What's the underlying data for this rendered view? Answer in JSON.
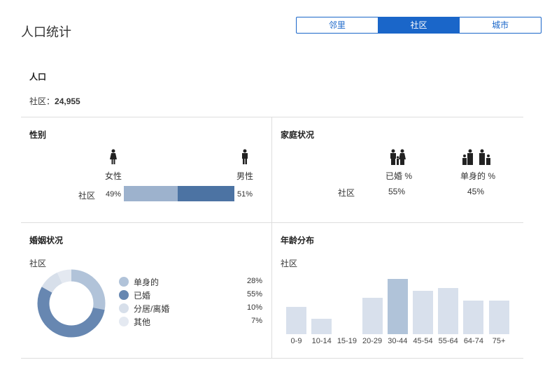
{
  "title": "人口统计",
  "tabs": [
    {
      "label": "邻里"
    },
    {
      "label": "社区",
      "active": true
    },
    {
      "label": "城市"
    }
  ],
  "population": {
    "heading": "人口",
    "label": "社区：",
    "value": "24,955"
  },
  "gender": {
    "heading": "性别",
    "female_label": "女性",
    "male_label": "男性",
    "row_label": "社区",
    "female_pct": "49%",
    "male_pct": "51%",
    "female_value": 49,
    "male_value": 51,
    "colors": {
      "female": "#9db2cd",
      "male": "#4c73a3"
    }
  },
  "family": {
    "heading": "家庭状况",
    "married_label": "已婚 %",
    "single_label": "单身的 %",
    "row_label": "社区",
    "married_pct": "55%",
    "single_pct": "45%"
  },
  "marital": {
    "heading": "婚姻状况",
    "sub": "社区",
    "items": [
      {
        "label": "单身的",
        "pct": "28%",
        "value": 28,
        "color": "#b1c3d9"
      },
      {
        "label": "已婚",
        "pct": "55%",
        "value": 55,
        "color": "#6787b1"
      },
      {
        "label": "分居/离婚",
        "pct": "10%",
        "value": 10,
        "color": "#d7dfea"
      },
      {
        "label": "其他",
        "pct": "7%",
        "value": 7,
        "color": "#e4e9f1"
      }
    ]
  },
  "age": {
    "heading": "年龄分布",
    "sub": "社区",
    "chart_data": {
      "type": "bar",
      "categories": [
        "0-9",
        "10-14",
        "15-19",
        "20-29",
        "30-44",
        "45-54",
        "55-64",
        "64-74",
        "75+"
      ],
      "values": [
        8,
        4.5,
        0,
        10.5,
        16,
        12.5,
        13.3,
        9.7,
        9.7
      ],
      "highlight": "30-44",
      "colors": {
        "default": "#d8e0ec",
        "highlight": "#b0c3d9"
      }
    }
  }
}
